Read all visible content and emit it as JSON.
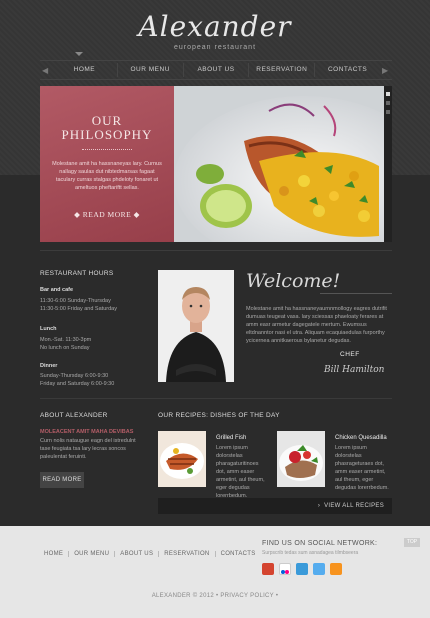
{
  "brand": {
    "logo": "Alexander",
    "tagline": "european restaurant"
  },
  "nav": {
    "items": [
      "HOME",
      "OUR MENU",
      "ABOUT US",
      "RESERVATION",
      "CONTACTS"
    ],
    "left_arrow": "◀",
    "right_arrow": "▶"
  },
  "slider": {
    "title_line1": "OUR",
    "title_line2": "PHILOSOPHY",
    "text": "Molestane amit ha hassnaneyas lary. Curnus nallagy saulas dut nibtedmarsas fagaat taculary curras stalgas phdeloty fonaret ut ameltuos pheftariftt sellas.",
    "read_more": "READ MORE"
  },
  "hours": {
    "title": "RESTAURANT HOURS",
    "groups": [
      {
        "label": "Bar and cafe",
        "lines": [
          "11:30-6:00 Sunday-Thursday",
          "11:30-5:00 Friday and Saturday"
        ]
      },
      {
        "label": "Lunch",
        "lines": [
          "Mon.-Sat. 11:30-3pm",
          "No lunch on Sunday"
        ]
      },
      {
        "label": "Dinner",
        "lines": [
          "Sunday-Thursday 6:00-9:30",
          "Friday and Saturday 6:00-9:30"
        ]
      }
    ]
  },
  "welcome": {
    "heading": "Welcome!",
    "text": "Molestane amit ha hassnaneyaurnnmollogy eagres dutrifit dumuas teugeat vasa. lary sciessas phaeloaty ferares at amm easr armetur dagegatele mertum. Ewumsus eltdnanntor nasi el utra. Aliquam ecaquiaedulas furporthy ycicernea annitkaerous bylanetur degudas.",
    "chef_label": "CHEF",
    "signature": "Bill Hamilton"
  },
  "about": {
    "title": "ABOUT ALEXANDER",
    "subtitle": "MOLEACENT AMIT MAHA DEVIBAS",
    "text": "Curn nolis nataugue eagn del istredulnt tase feugiata tsa lary lecras soncos paleulentat feruinti.",
    "button": "READ MORE"
  },
  "recipes": {
    "title": "OUR RECIPES: DISHES OF THE DAY",
    "items": [
      {
        "name": "Grilled Fish",
        "text": "Lorem ipsum dolorstelas pharagaturitinoes dot, amm easer armetint, aul theum, eger degudas lorerrbedum."
      },
      {
        "name": "Chicken Quesadilla",
        "text": "Lorem ipsum dolorstelas phasrageturaes dot, amm easer armetint, aul theum, eger degudas lorerrbedum."
      }
    ],
    "view_all": "VIEW ALL RECIPES"
  },
  "footer": {
    "nav": [
      "HOME",
      "OUR MENU",
      "ABOUT US",
      "RESERVATION",
      "CONTACTS"
    ],
    "social_title": "FIND US ON SOCIAL NETWORK:",
    "social_sub": "Surpscrib tedas sum asnadagea tilmbseera",
    "social_icons": [
      "google-plus-icon",
      "flickr-icon",
      "skype-icon",
      "twitter-icon",
      "rss-icon"
    ],
    "top": "TOP",
    "copyright": "ALEXANDER © 2012 • PRIVACY POLICY •"
  },
  "colors": {
    "accent": "#a94f59",
    "background": "#2b2b2b",
    "footer": "#e6e6e6"
  }
}
